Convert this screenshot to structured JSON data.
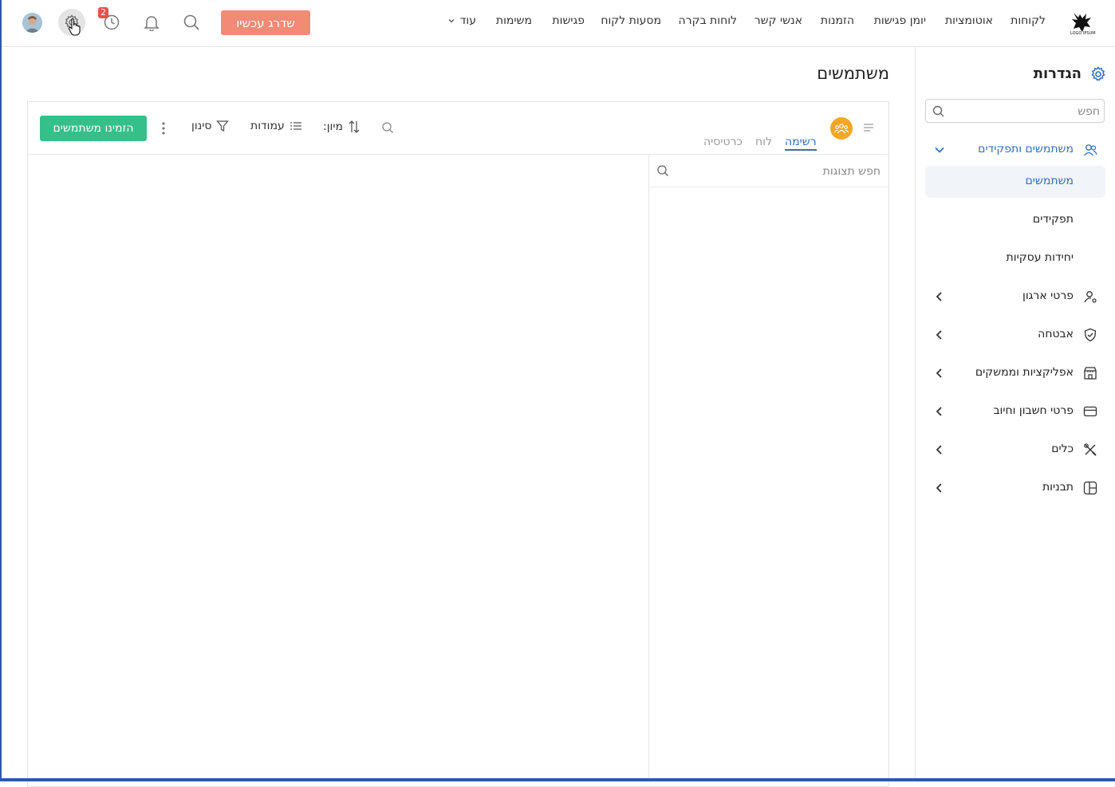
{
  "topnav": {
    "items": [
      "לקוחות",
      "אוטומציות",
      "יומן פגישות",
      "הזמנות",
      "אנשי קשר",
      "לוחות בקרה",
      "מסעות לקוח",
      "פגישות",
      "משימות"
    ],
    "more_label": "עוד",
    "upgrade_label": "שדרג עכשיו",
    "history_badge": "2",
    "logo_text": "LOGO IPSUM"
  },
  "sidebar": {
    "title": "הגדרות",
    "search_placeholder": "חפש",
    "section_users": "משתמשים ותפקידים",
    "sub_items": [
      "משתמשים",
      "תפקידים",
      "יחידות עסקיות"
    ],
    "sections": [
      "פרטי ארגון",
      "אבטחה",
      "אפליקציות וממשקים",
      "פרטי חשבון וחיוב",
      "כלים",
      "תבניות"
    ]
  },
  "main": {
    "title": "משתמשים",
    "invite_label": "הזמינו משתמשים",
    "filter_label": "סינון",
    "columns_label": "עמודות",
    "sort_label": "מיון:",
    "tabs": [
      "רשימה",
      "לוח",
      "כרטיסיה"
    ],
    "views_search_placeholder": "חפש תצוגות"
  },
  "colors": {
    "accent_blue": "#2e6fc1",
    "upgrade": "#f28a76",
    "invite": "#35c08a",
    "badge": "#e9504a",
    "avatar_orange": "#f5a623"
  }
}
